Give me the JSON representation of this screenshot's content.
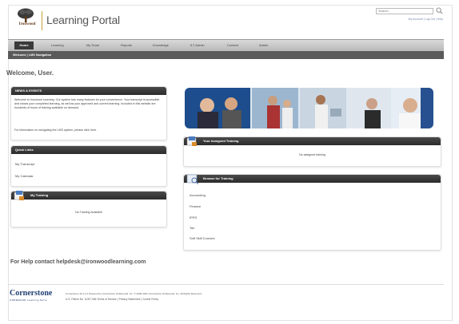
{
  "header": {
    "logo_text": "Ironwood",
    "portal_title": "Learning Portal",
    "search_placeholder": "Search",
    "account_links": "My Account | Log Out | Help"
  },
  "nav": {
    "items": [
      "Home",
      "Learning",
      "My Team",
      "Reports",
      "Knowledge",
      "ILT Admin",
      "Content",
      "Admin"
    ],
    "active": "Home"
  },
  "subnav": "Welcome | LMS Navigation",
  "welcome": "Welcome, User.",
  "news": {
    "title": "NEWS & EVENTS",
    "body": "Welcome to Ironwood Learning. Our system has many features for your convenience. Your transcript is accessible and shows your completed learning, as well as your approved and current learning. Included in this website are hundreds of hours of training available on demand.",
    "nav_info": "For information on navigating the LMS system, please click here."
  },
  "quick_links": {
    "title": "Quick Links",
    "items": [
      "My Transcript",
      "My Calendar"
    ]
  },
  "my_training": {
    "title": "My Training",
    "empty": "No Training Available"
  },
  "assigned": {
    "title": "Your Assigned Training",
    "empty": "No assigned training"
  },
  "browse": {
    "title": "Browse for Training",
    "items": [
      "Accounting",
      "Finance",
      "IFRS",
      "Tax",
      "Soft Skill Courses"
    ]
  },
  "help": "For Help contact helpdesk@ironwoodlearning.com",
  "footer": {
    "brand": "Cornerstone",
    "brand_sub": "ONDEMAND Learning Suite",
    "line1": "Cornerstone 11.2.1.0 Powered by Cornerstone OnDemand, Inc. © 2000-2011 Cornerstone OnDemand, Inc. All Rights Reserved.",
    "line2": "U.S. Patent No. 6,007,066   Terms of Service | Privacy Statement | Cookie Policy"
  }
}
